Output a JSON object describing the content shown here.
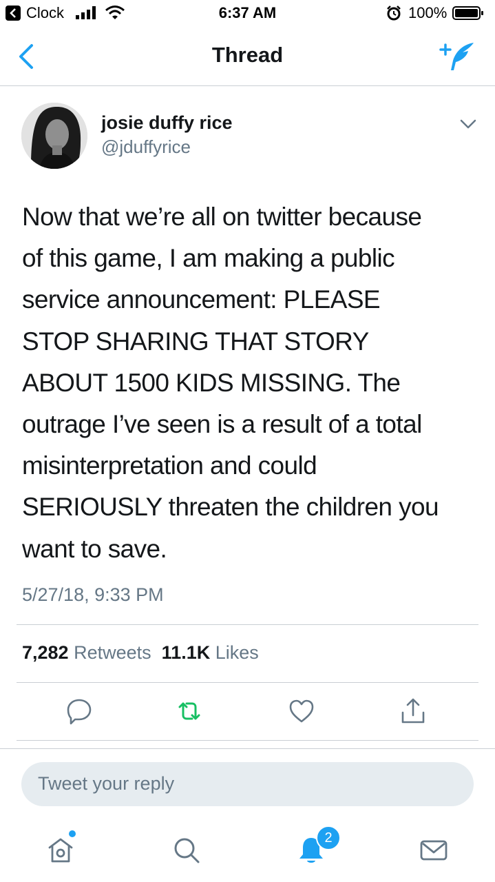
{
  "status_bar": {
    "back_app": "Clock",
    "time": "6:37 AM",
    "battery": "100%"
  },
  "nav": {
    "title": "Thread"
  },
  "tweet": {
    "author_name": "josie duffy rice",
    "author_handle": "@jduffyrice",
    "text_lines": [
      "Now that we’re all on twitter because",
      "of this game, I am making a public",
      "service announcement: PLEASE",
      "STOP SHARING THAT STORY",
      "ABOUT 1500 KIDS MISSING. The",
      "outrage I’ve seen is a result of a total",
      "misinterpretation and could",
      "SERIOUSLY threaten the children you",
      "want to save."
    ],
    "timestamp": "5/27/18, 9:33 PM",
    "retweet_count": "7,282",
    "retweet_label": "Retweets",
    "like_count": "11.1K",
    "like_label": "Likes"
  },
  "actions": [
    "reply-icon",
    "retweet-icon",
    "like-icon",
    "share-icon"
  ],
  "reply": {
    "placeholder": "Tweet your reply"
  },
  "tabbar": {
    "items": [
      "home-icon",
      "search-icon",
      "notifications-icon",
      "messages-icon"
    ],
    "notification_badge": "2"
  },
  "colors": {
    "accent": "#1da1f2",
    "retweet_green": "#17bf63",
    "text_primary": "#14171a",
    "text_secondary": "#657786"
  }
}
